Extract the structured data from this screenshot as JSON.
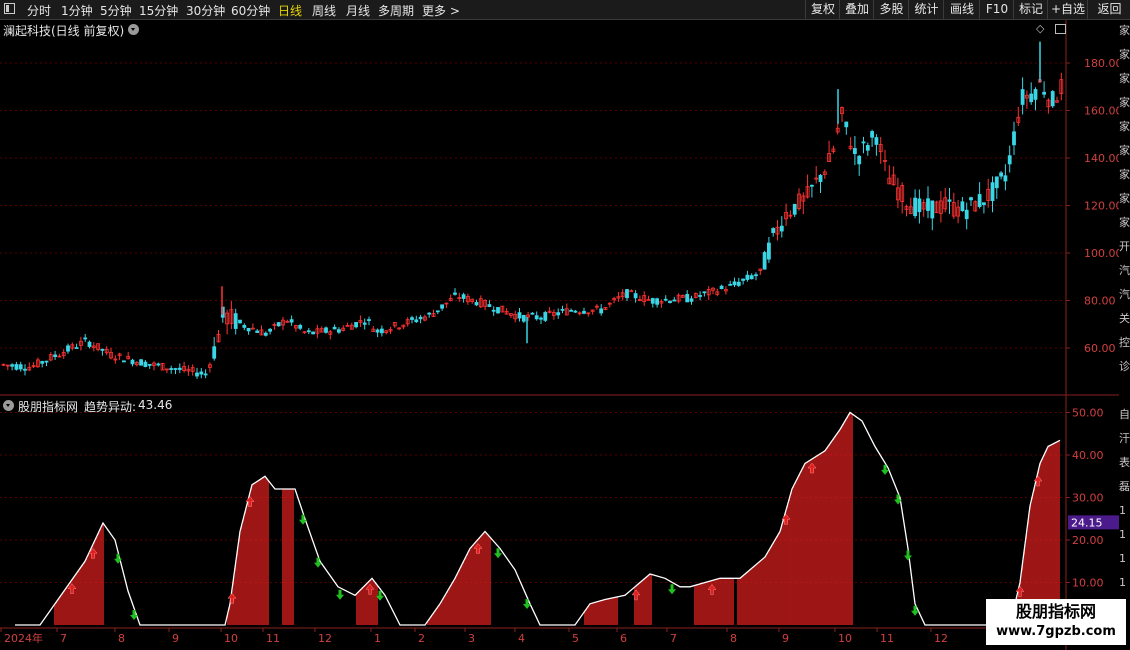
{
  "toolbar": {
    "periods": [
      "分时",
      "1分钟",
      "5分钟",
      "15分钟",
      "30分钟",
      "60分钟",
      "日线",
      "周线",
      "月线",
      "多周期",
      "更多 >"
    ],
    "active": "日线",
    "right_buttons": [
      "复权",
      "叠加",
      "多股",
      "统计",
      "画线",
      "F10",
      "标记",
      "+自选",
      "返回"
    ]
  },
  "main_chart": {
    "title": "澜起科技(日线 前复权)",
    "y_ticks": [
      "180.00",
      "160.00",
      "140.00",
      "120.00",
      "100.00",
      "80.00",
      "60.00"
    ],
    "y_values": [
      180,
      160,
      140,
      120,
      100,
      80,
      60
    ],
    "colors": {
      "up": "#ff3232",
      "down": "#39d6e6",
      "grid": "#5a0000",
      "axis_text": "#d04040"
    }
  },
  "indicator": {
    "title": "股朋指标网",
    "name": "趋势异动:",
    "value": "43.46",
    "y_ticks": [
      "50.00",
      "40.00",
      "30.00",
      "20.00",
      "10.00"
    ],
    "y_values": [
      50,
      40,
      30,
      20,
      10
    ],
    "current_label": "24.15",
    "current_value": 24.15,
    "colors": {
      "bar": "#e02020",
      "line": "#ffffff",
      "up_arrow": "#e02020",
      "down_arrow": "#20c020",
      "label_bg": "#4b1b8b"
    }
  },
  "x_axis": {
    "labels": [
      "2024年",
      "7",
      "8",
      "9",
      "10",
      "11",
      "12",
      "1",
      "2",
      "3",
      "4",
      "5",
      "6",
      "7",
      "8",
      "9",
      "10",
      "11",
      "12"
    ]
  },
  "right_strip": [
    "家",
    "家",
    "家",
    "家",
    "家",
    "家",
    "家",
    "家",
    "家",
    "开",
    "汽",
    "汽",
    "关",
    "控",
    "诊",
    "",
    "自",
    "汗",
    "表",
    "磊",
    "1",
    "1",
    "1",
    "1",
    "1",
    "1"
  ],
  "watermark": {
    "line1": "股朋指标网",
    "line2": "www.7gpzb.com"
  }
}
